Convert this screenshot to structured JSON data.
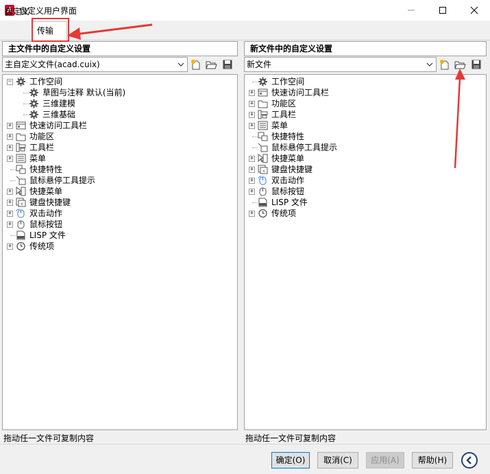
{
  "window": {
    "title": "自定义用户界面",
    "app_icon_letter": "A"
  },
  "tabs": [
    {
      "label": "自定义"
    },
    {
      "label": "传输"
    }
  ],
  "left_panel": {
    "header": "主文件中的自定义设置",
    "combo_value": "主自定义文件(acad.cuix)",
    "status": "拖动任一文件可复制内容",
    "tree": [
      {
        "label": "工作空间",
        "icon": "gear-icon",
        "expander": "−"
      },
      {
        "label": "草图与注释 默认(当前)",
        "icon": "gear-icon"
      },
      {
        "label": "三维建模",
        "icon": "gear-icon"
      },
      {
        "label": "三维基础",
        "icon": "gear-icon"
      },
      {
        "label": "快速访问工具栏",
        "icon": "toolbar-icon",
        "expander": "+"
      },
      {
        "label": "功能区",
        "icon": "ribbon-icon",
        "expander": "+"
      },
      {
        "label": "工具栏",
        "icon": "toolbars-icon",
        "expander": "+"
      },
      {
        "label": "菜单",
        "icon": "menu-icon",
        "expander": "+"
      },
      {
        "label": "快捷特性",
        "icon": "quick-properties-icon"
      },
      {
        "label": "鼠标悬停工具提示",
        "icon": "tooltip-icon"
      },
      {
        "label": "快捷菜单",
        "icon": "shortcut-menu-icon",
        "expander": "+"
      },
      {
        "label": "键盘快捷键",
        "icon": "keyboard-icon",
        "expander": "+"
      },
      {
        "label": "双击动作",
        "icon": "double-click-icon",
        "expander": "+"
      },
      {
        "label": "鼠标按钮",
        "icon": "mouse-icon",
        "expander": "+"
      },
      {
        "label": "LISP 文件",
        "icon": "lisp-file-icon"
      },
      {
        "label": "传统项",
        "icon": "clock-icon",
        "expander": "+"
      }
    ]
  },
  "right_panel": {
    "header": "新文件中的自定义设置",
    "combo_value": "新文件",
    "status": "拖动任一文件可复制内容",
    "tree": [
      {
        "label": "工作空间",
        "icon": "gear-icon"
      },
      {
        "label": "快速访问工具栏",
        "icon": "toolbar-icon",
        "expander": "+"
      },
      {
        "label": "功能区",
        "icon": "ribbon-icon",
        "expander": "+"
      },
      {
        "label": "工具栏",
        "icon": "toolbars-icon",
        "expander": "+"
      },
      {
        "label": "菜单",
        "icon": "menu-icon",
        "expander": "+"
      },
      {
        "label": "快捷特性",
        "icon": "quick-properties-icon"
      },
      {
        "label": "鼠标悬停工具提示",
        "icon": "tooltip-icon"
      },
      {
        "label": "快捷菜单",
        "icon": "shortcut-menu-icon",
        "expander": "+"
      },
      {
        "label": "键盘快捷键",
        "icon": "keyboard-icon",
        "expander": "+"
      },
      {
        "label": "双击动作",
        "icon": "double-click-icon",
        "expander": "+"
      },
      {
        "label": "鼠标按钮",
        "icon": "mouse-icon",
        "expander": "+"
      },
      {
        "label": "LISP 文件",
        "icon": "lisp-file-icon"
      },
      {
        "label": "传统项",
        "icon": "clock-icon",
        "expander": "+"
      }
    ]
  },
  "buttons": {
    "ok": "确定(O)",
    "cancel": "取消(C)",
    "apply": "应用(A)",
    "help": "帮助(H)"
  },
  "colors": {
    "annotation": "#e53935",
    "accent": "#0078d7",
    "app_icon": "#c8102e"
  }
}
